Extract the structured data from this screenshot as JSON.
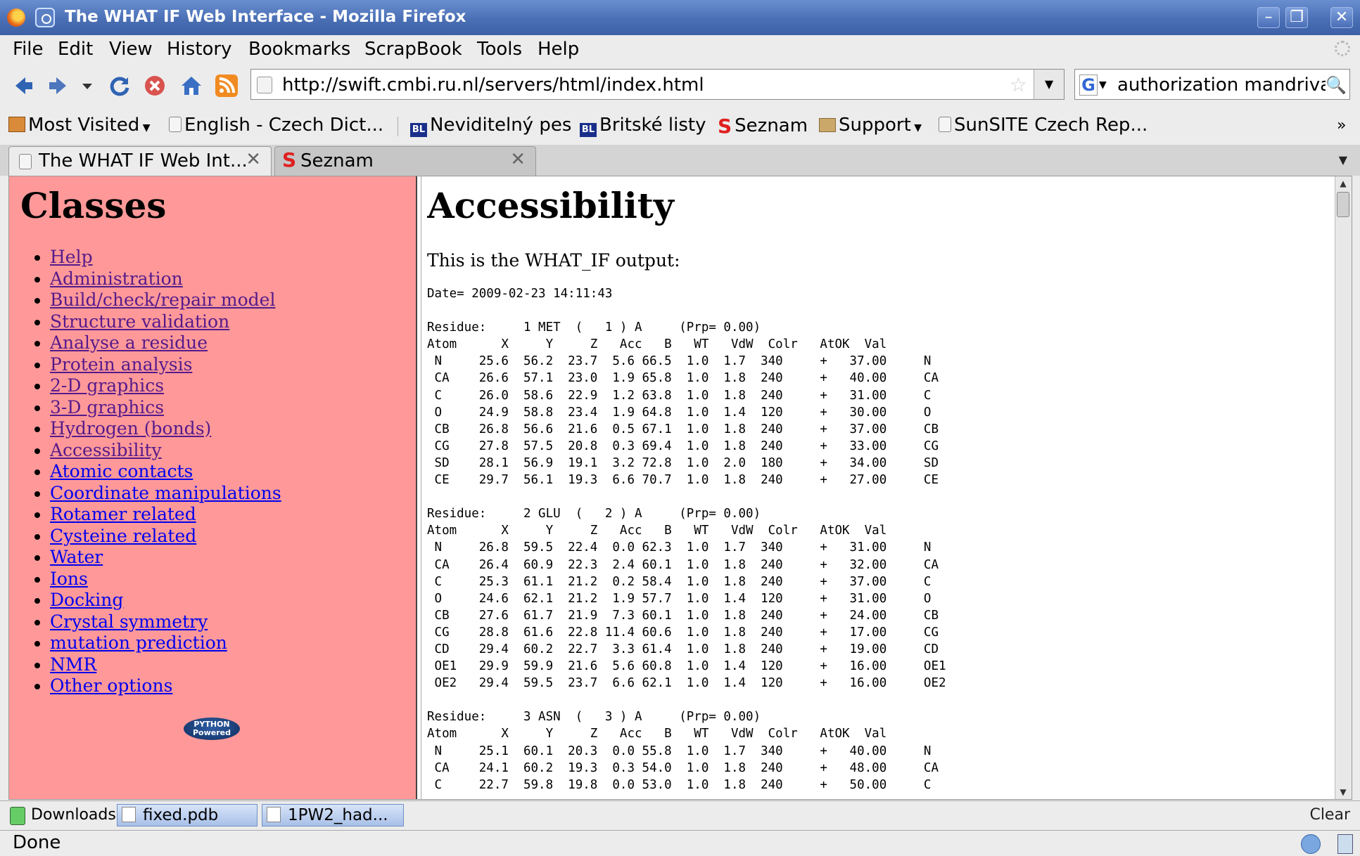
{
  "window": {
    "title": "The WHAT IF Web Interface - Mozilla Firefox"
  },
  "menu": [
    "File",
    "Edit",
    "View",
    "History",
    "Bookmarks",
    "ScrapBook",
    "Tools",
    "Help"
  ],
  "navbar": {
    "url": "http://swift.cmbi.ru.nl/servers/html/index.html",
    "search_value": "authorization mandriva"
  },
  "bookmarks": [
    {
      "label": "Most Visited",
      "icon": "most-visited-icon",
      "dropdown": true
    },
    {
      "label": "English - Czech Dict...",
      "icon": "page-icon"
    },
    {
      "label": "Neviditelný pes",
      "icon": "bl-icon",
      "badge": "BL"
    },
    {
      "label": "Britské listy",
      "icon": "bl-icon",
      "badge": "BL"
    },
    {
      "label": "Seznam",
      "icon": "seznam-icon",
      "badge": "S"
    },
    {
      "label": "Support",
      "icon": "folder-icon",
      "dropdown": true
    },
    {
      "label": "SunSITE Czech Rep...",
      "icon": "page-icon"
    }
  ],
  "bookmarks_overflow": "»",
  "tabs": [
    {
      "label": "The WHAT IF Web Int...",
      "active": true
    },
    {
      "label": "Seznam",
      "active": false
    }
  ],
  "sidebar": {
    "heading": "Classes",
    "items": [
      "Help",
      "Administration",
      "Build/check/repair model",
      "Structure validation",
      "Analyse a residue",
      "Protein analysis",
      "2-D graphics",
      "3-D graphics",
      "Hydrogen (bonds)",
      "Accessibility",
      "Atomic contacts",
      "Coordinate manipulations",
      "Rotamer related",
      "Cysteine related",
      "Water",
      "Ions",
      "Docking",
      "Crystal symmetry",
      "mutation prediction",
      "NMR",
      "Other options"
    ],
    "visited": [
      "Help",
      "Administration",
      "Build/check/repair model",
      "Structure validation",
      "Analyse a residue",
      "Protein analysis",
      "2-D graphics",
      "3-D graphics",
      "Hydrogen (bonds)",
      "Accessibility"
    ],
    "logo_text": "PYTHON Powered"
  },
  "main": {
    "heading": "Accessibility",
    "intro": "This is the WHAT_IF output:",
    "output_lines": [
      "Date= 2009-02-23 14:11:43",
      "",
      "Residue:     1 MET  (   1 ) A     (Prp= 0.00)",
      "Atom      X     Y     Z   Acc   B   WT   VdW  Colr   AtOK  Val",
      " N     25.6  56.2  23.7  5.6 66.5  1.0  1.7  340     +   37.00     N",
      " CA    26.6  57.1  23.0  1.9 65.8  1.0  1.8  240     +   40.00     CA",
      " C     26.0  58.6  22.9  1.2 63.8  1.0  1.8  240     +   31.00     C",
      " O     24.9  58.8  23.4  1.9 64.8  1.0  1.4  120     +   30.00     O",
      " CB    26.8  56.6  21.6  0.5 67.1  1.0  1.8  240     +   37.00     CB",
      " CG    27.8  57.5  20.8  0.3 69.4  1.0  1.8  240     +   33.00     CG",
      " SD    28.1  56.9  19.1  3.2 72.8  1.0  2.0  180     +   34.00     SD",
      " CE    29.7  56.1  19.3  6.6 70.7  1.0  1.8  240     +   27.00     CE",
      "",
      "Residue:     2 GLU  (   2 ) A     (Prp= 0.00)",
      "Atom      X     Y     Z   Acc   B   WT   VdW  Colr   AtOK  Val",
      " N     26.8  59.5  22.4  0.0 62.3  1.0  1.7  340     +   31.00     N",
      " CA    26.4  60.9  22.3  2.4 60.1  1.0  1.8  240     +   32.00     CA",
      " C     25.3  61.1  21.2  0.2 58.4  1.0  1.8  240     +   37.00     C",
      " O     24.6  62.1  21.2  1.9 57.7  1.0  1.4  120     +   31.00     O",
      " CB    27.6  61.7  21.9  7.3 60.1  1.0  1.8  240     +   24.00     CB",
      " CG    28.8  61.6  22.8 11.4 60.6  1.0  1.8  240     +   17.00     CG",
      " CD    29.4  60.2  22.7  3.3 61.4  1.0  1.8  240     +   19.00     CD",
      " OE1   29.9  59.9  21.6  5.6 60.8  1.0  1.4  120     +   16.00     OE1",
      " OE2   29.4  59.5  23.7  6.6 62.1  1.0  1.4  120     +   16.00     OE2",
      "",
      "Residue:     3 ASN  (   3 ) A     (Prp= 0.00)",
      "Atom      X     Y     Z   Acc   B   WT   VdW  Colr   AtOK  Val",
      " N     25.1  60.1  20.3  0.0 55.8  1.0  1.7  340     +   40.00     N",
      " CA    24.1  60.2  19.3  0.3 54.0  1.0  1.8  240     +   48.00     CA",
      " C     22.7  59.8  19.8  0.0 53.0  1.0  1.8  240     +   50.00     C"
    ]
  },
  "downloads": {
    "label": "Downloads",
    "items": [
      "fixed.pdb",
      "1PW2_had..."
    ],
    "clear_label": "Clear"
  },
  "status": {
    "text": "Done"
  },
  "colors": {
    "sidebar_bg": "#ff9999",
    "link": "#0000ee",
    "visited_link": "#551a8b",
    "titlebar": "#4a6fb5"
  }
}
